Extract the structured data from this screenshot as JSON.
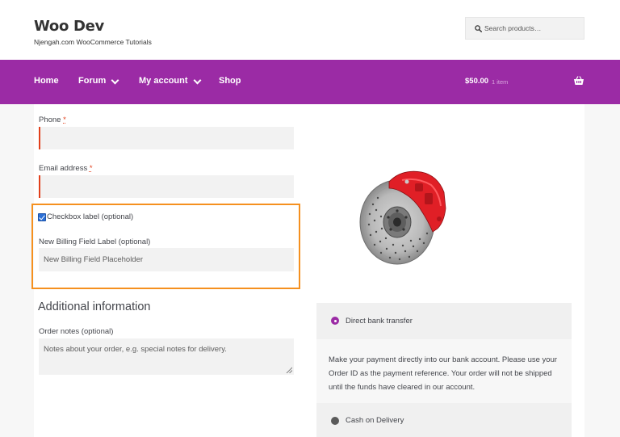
{
  "site": {
    "title": "Woo Dev",
    "tagline": "Njengah.com WooCommerce Tutorials"
  },
  "search": {
    "placeholder": "Search products…",
    "icon": "search-icon"
  },
  "nav": {
    "items": [
      {
        "label": "Home",
        "has_dropdown": false
      },
      {
        "label": "Forum",
        "has_dropdown": true
      },
      {
        "label": "My account",
        "has_dropdown": true
      },
      {
        "label": "Shop",
        "has_dropdown": false
      }
    ],
    "cart_total": "$50.00",
    "cart_count": "1 item",
    "cart_icon": "basket-icon",
    "background": "#9b2ba5"
  },
  "billing": {
    "phone_label": "Phone",
    "email_label": "Email address",
    "required_mark": "*",
    "checkbox_label": "Checkbox label (optional)",
    "checkbox_checked": true,
    "new_field_label": "New Billing Field Label (optional)",
    "new_field_placeholder": "New Billing Field Placeholder",
    "highlight_color": "#f5901f"
  },
  "additional": {
    "heading": "Additional information",
    "notes_label": "Order notes (optional)",
    "notes_placeholder": "Notes about your order, e.g. special notes for delivery."
  },
  "product": {
    "image": "brake-disc-image"
  },
  "payment": {
    "methods": [
      {
        "label": "Direct bank transfer",
        "selected": true
      },
      {
        "label": "Cash on Delivery",
        "selected": false
      }
    ],
    "bank_description": "Make your payment directly into our bank account. Please use your Order ID as the payment reference. Your order will not be shipped until the funds have cleared in our account."
  }
}
